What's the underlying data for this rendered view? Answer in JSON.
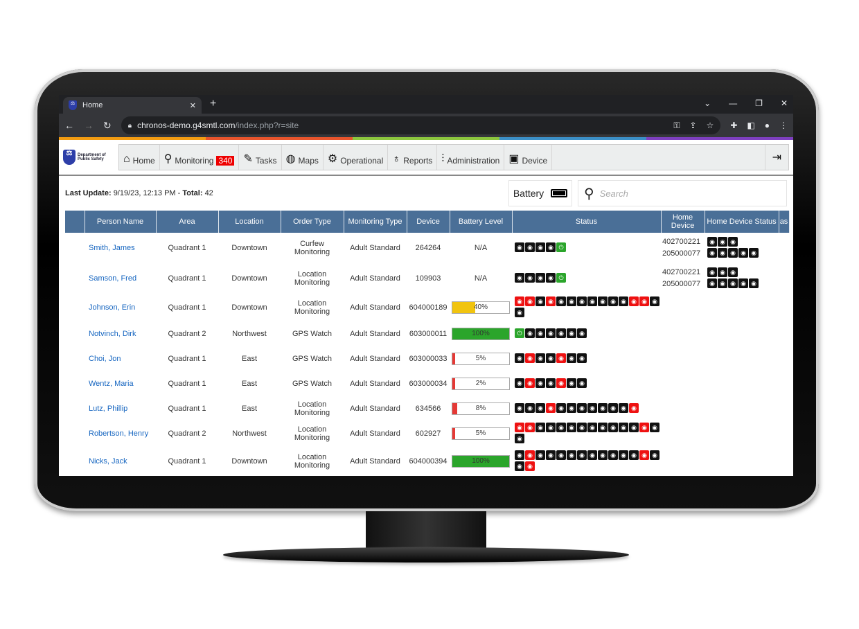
{
  "browser": {
    "tab_title": "Home",
    "url_host": "chronos-demo.g4smtl.com",
    "url_path": "/index.php?r=site"
  },
  "logo": {
    "text": "Department of Public Safety"
  },
  "nav": [
    {
      "label": "Home",
      "icon": "⌂",
      "name": "home"
    },
    {
      "label": "Monitoring",
      "icon": "⚲",
      "name": "monitoring",
      "badge": "340"
    },
    {
      "label": "Tasks",
      "icon": "✎",
      "name": "tasks"
    },
    {
      "label": "Maps",
      "icon": "◍",
      "name": "maps"
    },
    {
      "label": "Operational",
      "icon": "⚙",
      "name": "operational"
    },
    {
      "label": "Reports",
      "icon": "♁",
      "name": "reports"
    },
    {
      "label": "Administration",
      "icon": "⫶",
      "name": "administration"
    },
    {
      "label": "Device",
      "icon": "▣",
      "name": "device"
    }
  ],
  "header": {
    "last_update_label": "Last Update:",
    "last_update": "9/19/23, 12:13 PM",
    "sep": " - ",
    "total_label": "Total:",
    "total": "42",
    "battery_label": "Battery",
    "search_placeholder": "Search"
  },
  "columns": [
    "",
    "Person Name",
    "Area",
    "Location",
    "Order Type",
    "Monitoring Type",
    "Device",
    "Battery Level",
    "Status",
    "Home Device",
    "Home Device Status",
    "as"
  ],
  "colors": {
    "header": "#4a6f97",
    "link": "#1565c0",
    "low": "#e53935",
    "mid": "#f1c40f",
    "full": "#2ba52b"
  },
  "rows": [
    {
      "name": "Smith, James",
      "area": "Quadrant 1",
      "location": "Downtown",
      "order": "Curfew Monitoring",
      "mtype": "Adult Standard",
      "device": "264264",
      "battery": "N/A",
      "status": "kkkkg",
      "home": [
        {
          "id": "402700221",
          "status": "kkk"
        },
        {
          "id": "205000077",
          "status": "kkkkk"
        }
      ]
    },
    {
      "name": "Samson, Fred",
      "area": "Quadrant 1",
      "location": "Downtown",
      "order": "Location Monitoring",
      "mtype": "Adult Standard",
      "device": "109903",
      "battery": "N/A",
      "status": "kkkkg",
      "home": [
        {
          "id": "402700221",
          "status": "kkk"
        },
        {
          "id": "205000077",
          "status": "kkkkk"
        }
      ]
    },
    {
      "name": "Johnson, Erin",
      "area": "Quadrant 1",
      "location": "Downtown",
      "order": "Location Monitoring",
      "mtype": "Adult Standard",
      "device": "604000189",
      "battery": "40%",
      "battery_pct": 40,
      "status": "rrkrkkkkkkkrrkk",
      "home": []
    },
    {
      "name": "Notvinch, Dirk",
      "area": "Quadrant 2",
      "location": "Northwest",
      "order": "GPS Watch",
      "mtype": "Adult Standard",
      "device": "603000011",
      "battery": "100%",
      "battery_pct": 100,
      "status": "gkkkkkk",
      "home": []
    },
    {
      "name": "Choi, Jon",
      "area": "Quadrant 1",
      "location": "East",
      "order": "GPS Watch",
      "mtype": "Adult Standard",
      "device": "603000033",
      "battery": "5%",
      "battery_pct": 5,
      "status": "krkkrkk",
      "home": []
    },
    {
      "name": "Wentz, Maria",
      "area": "Quadrant 1",
      "location": "East",
      "order": "GPS Watch",
      "mtype": "Adult Standard",
      "device": "603000034",
      "battery": "2%",
      "battery_pct": 2,
      "status": "krkkrkk",
      "home": []
    },
    {
      "name": "Lutz, Phillip",
      "area": "Quadrant 1",
      "location": "East",
      "order": "Location Monitoring",
      "mtype": "Adult Standard",
      "device": "634566",
      "battery": "8%",
      "battery_pct": 8,
      "status": "kkkrkkkkkkkr",
      "home": []
    },
    {
      "name": "Robertson, Henry",
      "area": "Quadrant 2",
      "location": "Northwest",
      "order": "Location Monitoring",
      "mtype": "Adult Standard",
      "device": "602927",
      "battery": "5%",
      "battery_pct": 5,
      "status": "rrkkkkkkkkkkrkk",
      "home": []
    },
    {
      "name": "Nicks, Jack",
      "area": "Quadrant 1",
      "location": "Downtown",
      "order": "Location Monitoring",
      "mtype": "Adult Standard",
      "device": "604000394",
      "battery": "100%",
      "battery_pct": 100,
      "status": "krkkkkkkkkkkrkkr",
      "home": []
    }
  ]
}
